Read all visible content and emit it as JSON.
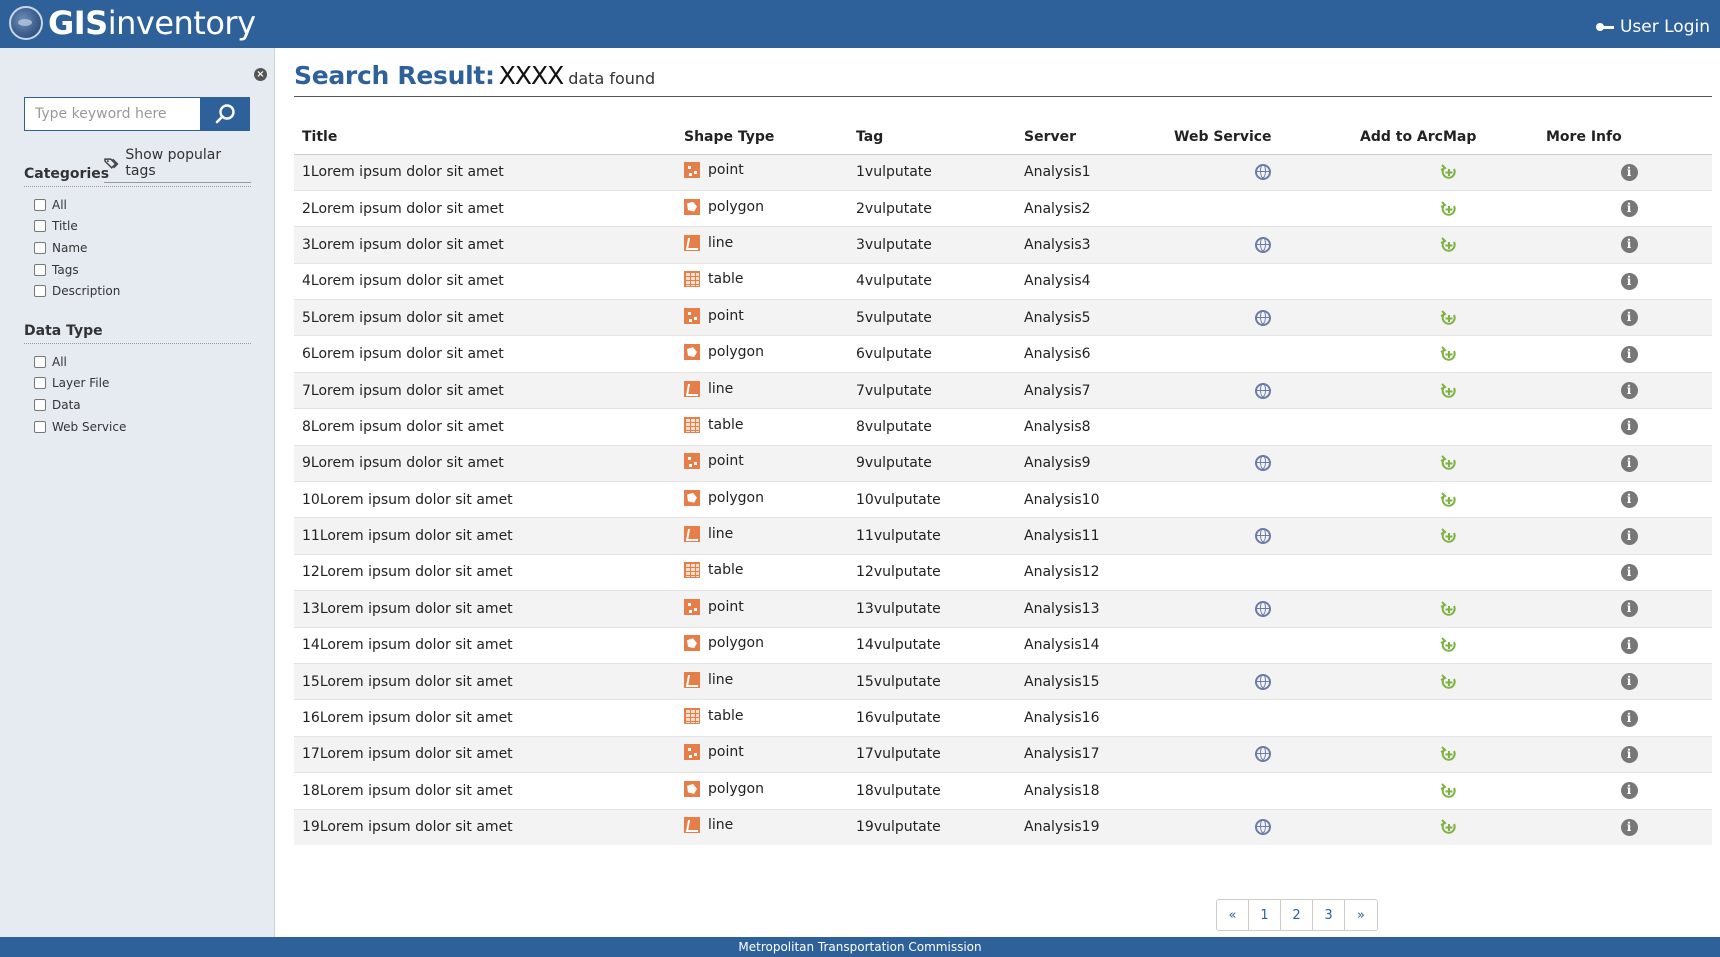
{
  "header": {
    "logo_prefix": "GIS",
    "logo_suffix": "inventory",
    "user_login": "User Login"
  },
  "sidebar": {
    "search_placeholder": "Type keyword here",
    "popular_tags": "Show popular tags",
    "categories_title": "Categories",
    "categories": [
      "All",
      "Title",
      "Name",
      "Tags",
      "Description"
    ],
    "data_type_title": "Data Type",
    "data_types": [
      "All",
      "Layer File",
      "Data",
      "Web Service"
    ]
  },
  "main": {
    "result_label": "Search Result:",
    "result_count": "XXXX",
    "result_suffix": "data found",
    "columns": [
      "Title",
      "Shape Type",
      "Tag",
      "Server",
      "Web Service",
      "Add to ArcMap",
      "More Info"
    ],
    "rows": [
      {
        "title": "1Lorem ipsum dolor sit amet",
        "shape": "point",
        "tag": "1vulputate",
        "server": "Analysis1",
        "ws": true,
        "arc": true
      },
      {
        "title": "2Lorem ipsum dolor sit amet",
        "shape": "polygon",
        "tag": "2vulputate",
        "server": "Analysis2",
        "ws": false,
        "arc": true
      },
      {
        "title": "3Lorem ipsum dolor sit amet",
        "shape": "line",
        "tag": "3vulputate",
        "server": "Analysis3",
        "ws": true,
        "arc": true
      },
      {
        "title": "4Lorem ipsum dolor sit amet",
        "shape": "table",
        "tag": "4vulputate",
        "server": "Analysis4",
        "ws": false,
        "arc": false
      },
      {
        "title": "5Lorem ipsum dolor sit amet",
        "shape": "point",
        "tag": "5vulputate",
        "server": "Analysis5",
        "ws": true,
        "arc": true
      },
      {
        "title": "6Lorem ipsum dolor sit amet",
        "shape": "polygon",
        "tag": "6vulputate",
        "server": "Analysis6",
        "ws": false,
        "arc": true
      },
      {
        "title": "7Lorem ipsum dolor sit amet",
        "shape": "line",
        "tag": "7vulputate",
        "server": "Analysis7",
        "ws": true,
        "arc": true
      },
      {
        "title": "8Lorem ipsum dolor sit amet",
        "shape": "table",
        "tag": "8vulputate",
        "server": "Analysis8",
        "ws": false,
        "arc": false
      },
      {
        "title": "9Lorem ipsum dolor sit amet",
        "shape": "point",
        "tag": "9vulputate",
        "server": "Analysis9",
        "ws": true,
        "arc": true
      },
      {
        "title": "10Lorem ipsum dolor sit amet",
        "shape": "polygon",
        "tag": "10vulputate",
        "server": "Analysis10",
        "ws": false,
        "arc": true
      },
      {
        "title": "11Lorem ipsum dolor sit amet",
        "shape": "line",
        "tag": "11vulputate",
        "server": "Analysis11",
        "ws": true,
        "arc": true
      },
      {
        "title": "12Lorem ipsum dolor sit amet",
        "shape": "table",
        "tag": "12vulputate",
        "server": "Analysis12",
        "ws": false,
        "arc": false
      },
      {
        "title": "13Lorem ipsum dolor sit amet",
        "shape": "point",
        "tag": "13vulputate",
        "server": "Analysis13",
        "ws": true,
        "arc": true
      },
      {
        "title": "14Lorem ipsum dolor sit amet",
        "shape": "polygon",
        "tag": "14vulputate",
        "server": "Analysis14",
        "ws": false,
        "arc": true
      },
      {
        "title": "15Lorem ipsum dolor sit amet",
        "shape": "line",
        "tag": "15vulputate",
        "server": "Analysis15",
        "ws": true,
        "arc": true
      },
      {
        "title": "16Lorem ipsum dolor sit amet",
        "shape": "table",
        "tag": "16vulputate",
        "server": "Analysis16",
        "ws": false,
        "arc": false
      },
      {
        "title": "17Lorem ipsum dolor sit amet",
        "shape": "point",
        "tag": "17vulputate",
        "server": "Analysis17",
        "ws": true,
        "arc": true
      },
      {
        "title": "18Lorem ipsum dolor sit amet",
        "shape": "polygon",
        "tag": "18vulputate",
        "server": "Analysis18",
        "ws": false,
        "arc": true
      },
      {
        "title": "19Lorem ipsum dolor sit amet",
        "shape": "line",
        "tag": "19vulputate",
        "server": "Analysis19",
        "ws": true,
        "arc": true
      }
    ]
  },
  "pagination": [
    "«",
    "1",
    "2",
    "3",
    "»"
  ],
  "footer": {
    "text": "Metropolitan Transportation Commission"
  },
  "colors": {
    "brand": "#2e6199",
    "shape_icon": "#e67e4a",
    "arcmap_icon": "#7cb342",
    "web_service_icon": "#6b7ba8"
  },
  "icons": {
    "point": "point-shape-icon",
    "polygon": "polygon-shape-icon",
    "line": "line-shape-icon",
    "table": "table-shape-icon",
    "web_service": "globe-icon",
    "add_to_arcmap": "add-layer-icon",
    "more_info": "info-icon"
  }
}
